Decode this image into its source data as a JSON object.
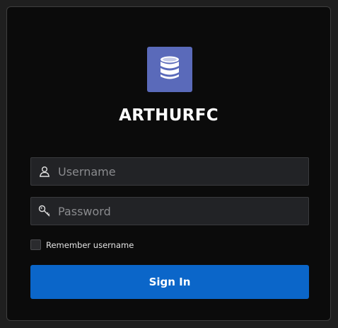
{
  "app": {
    "title": "ARTHURFC",
    "logo_icon": "database-icon",
    "logo_color": "#5a6aba"
  },
  "login_form": {
    "username": {
      "icon": "user-icon",
      "placeholder": "Username",
      "value": ""
    },
    "password": {
      "icon": "key-icon",
      "placeholder": "Password",
      "value": ""
    },
    "remember": {
      "label": "Remember username",
      "checked": false
    },
    "submit_label": "Sign In"
  },
  "colors": {
    "accent": "#0b66c9",
    "background": "#0b0b0b",
    "field_background": "#222326"
  }
}
